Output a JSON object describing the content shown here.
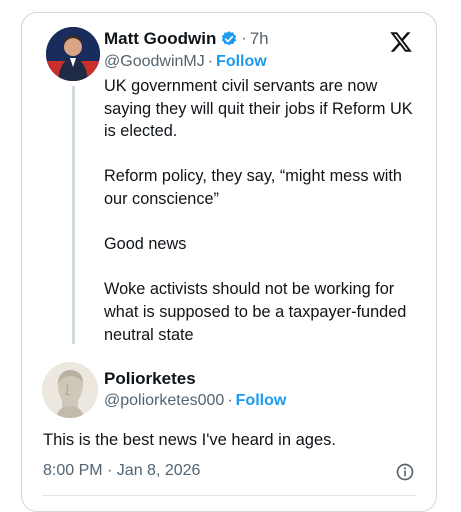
{
  "tweet": {
    "author_name": "Matt Goodwin",
    "time": "7h",
    "handle": "@GoodwinMJ",
    "follow_label": "Follow",
    "paragraphs": [
      "UK government civil servants are now saying they will quit their jobs if Reform UK is elected.",
      "Reform policy, they say, “might mess with our conscience”",
      "Good news",
      "Woke activists should not be working for what is supposed to be a taxpayer-funded neutral state"
    ]
  },
  "reply": {
    "author_name": "Poliorketes",
    "handle": "@poliorketes000",
    "follow_label": "Follow",
    "text": "This is the best news I've heard in ages.",
    "timestamp": "8:00 PM · Jan 8, 2026"
  },
  "separator": "·",
  "icons": {
    "verified": "verified-badge-icon",
    "platform": "x-logo-icon",
    "info": "info-icon"
  },
  "colors": {
    "accent": "#1d9bf0",
    "text": "#0f1419",
    "secondary": "#536471",
    "border": "#cfd9de"
  }
}
